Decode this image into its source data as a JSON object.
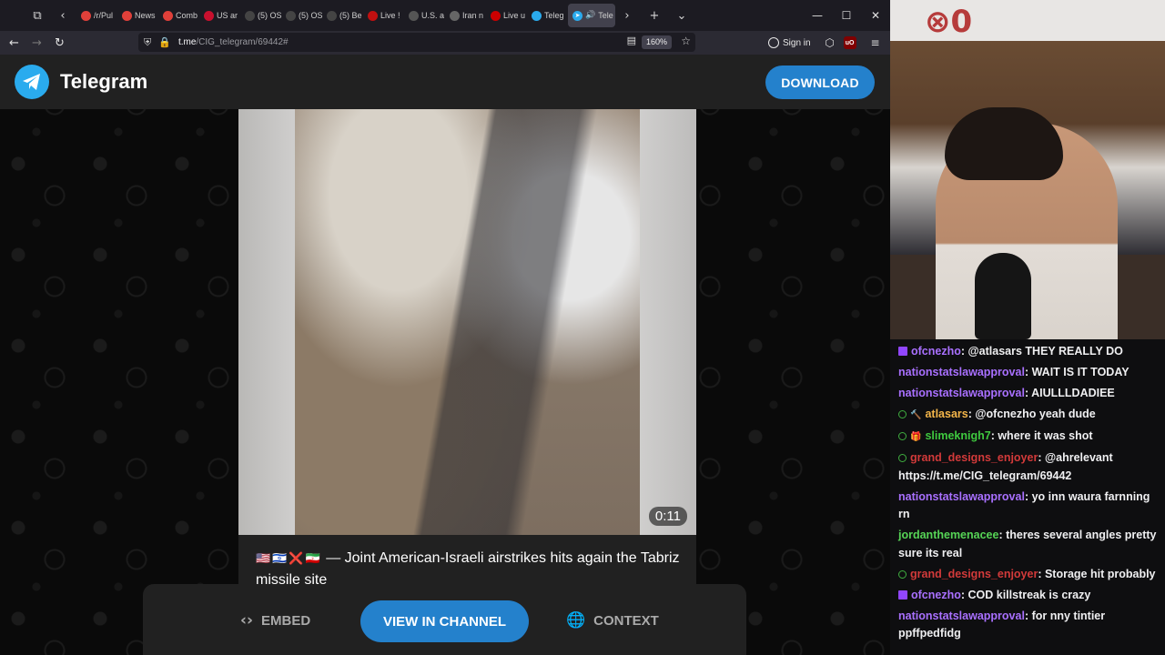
{
  "browser": {
    "tabs": [
      {
        "label": "/r/Pul",
        "color": "#e0403a"
      },
      {
        "label": "News",
        "color": "#e0403a"
      },
      {
        "label": "Comb",
        "color": "#e0403a"
      },
      {
        "label": "US ar",
        "color": "#c8102e"
      },
      {
        "label": "(5) OS",
        "color": "#444"
      },
      {
        "label": "(5) OS",
        "color": "#444"
      },
      {
        "label": "(5) Be",
        "color": "#444"
      },
      {
        "label": "Live !",
        "color": "#c01010"
      },
      {
        "label": "U.S. a",
        "color": "#555"
      },
      {
        "label": "Iran n",
        "color": "#666"
      },
      {
        "label": "Live u",
        "color": "#cc0000"
      },
      {
        "label": "Teleg",
        "color": "#2aabee"
      }
    ],
    "active_tab": {
      "label": "Tele",
      "color": "#2aabee"
    },
    "url_host": "t.me",
    "url_path": "/CIG_telegram/69442#",
    "zoom": "160%",
    "signin_label": "Sign in",
    "ublock_label": "uO"
  },
  "telegram": {
    "brand": "Telegram",
    "download_label": "DOWNLOAD",
    "video_duration": "0:11",
    "caption_flags": "🇺🇸🇮🇱❌🇮🇷",
    "caption_text": " — Joint American-Israeli airstrikes hits again the Tabriz missile site",
    "embed_label": "EMBED",
    "view_label": "VIEW IN CHANNEL",
    "context_label": "CONTEXT"
  },
  "chat": [
    {
      "badge": "purple",
      "extra": "",
      "user": "ofcnezho",
      "color": "purple",
      "text": ": @atlasars THEY REALLY DO"
    },
    {
      "badge": "",
      "extra": "",
      "user": "nationstatslawapproval",
      "color": "purple",
      "text": ": WAIT IS IT TODAY"
    },
    {
      "badge": "",
      "extra": "",
      "user": "nationstatslawapproval",
      "color": "purple",
      "text": ": AIULLLDADIEE"
    },
    {
      "badge": "green",
      "extra": "🔨",
      "user": "atlasars",
      "color": "orange",
      "text": ": @ofcnezho yeah dude"
    },
    {
      "badge": "green",
      "extra": "🎁",
      "user": "slimeknigh7",
      "color": "green",
      "text": ": where it was shot"
    },
    {
      "badge": "green",
      "extra": "",
      "user": "grand_designs_enjoyer",
      "color": "red",
      "text": ": @ahrelevant https://t.me/CIG_telegram/69442"
    },
    {
      "badge": "",
      "extra": "",
      "user": "nationstatslawapproval",
      "color": "purple",
      "text": ": yo inn waura farnning rn"
    },
    {
      "badge": "",
      "extra": "",
      "user": "jordanthemenacee",
      "color": "lime",
      "text": ": theres several angles pretty sure its real"
    },
    {
      "badge": "green",
      "extra": "",
      "user": "grand_designs_enjoyer",
      "color": "red",
      "text": ": Storage hit probably"
    },
    {
      "badge": "purple",
      "extra": "",
      "user": "ofcnezho",
      "color": "purple",
      "text": ": COD killstreak is crazy"
    },
    {
      "badge": "",
      "extra": "",
      "user": "nationstatslawapproval",
      "color": "purple",
      "text": ": for nny tintier ppffpedfidg"
    }
  ]
}
